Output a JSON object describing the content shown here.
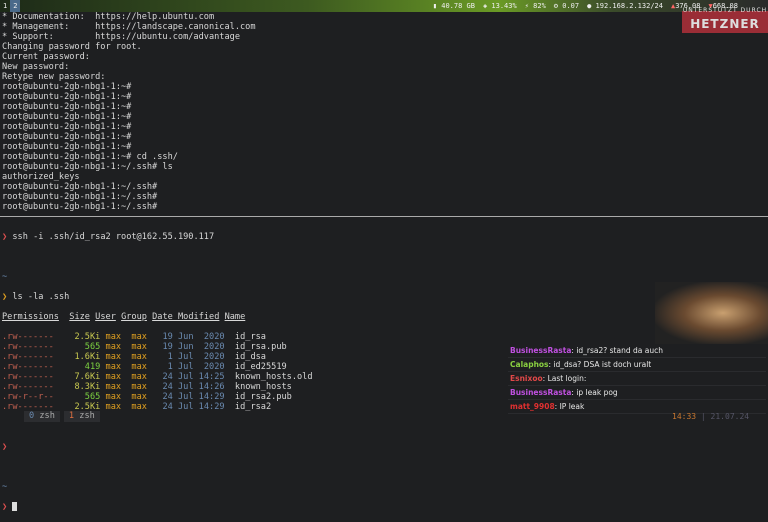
{
  "topbar": {
    "workspaces": [
      "1",
      "2"
    ],
    "disk": "40.78 GB",
    "cpu": "13.43%",
    "mem": "82%",
    "load": "0.07",
    "ip": "192.168.2.132/24",
    "up": "376.08",
    "down": "668.08"
  },
  "logo": {
    "top": "UNTERSTÜTZT DURCH",
    "name": "HETZNER"
  },
  "top_pane": [
    "* Documentation:  https://help.ubuntu.com",
    "* Management:     https://landscape.canonical.com",
    "* Support:        https://ubuntu.com/advantage",
    "Changing password for root.",
    "Current password:",
    "New password:",
    "Retype new password:",
    "root@ubuntu-2gb-nbg1-1:~#",
    "root@ubuntu-2gb-nbg1-1:~#",
    "root@ubuntu-2gb-nbg1-1:~#",
    "root@ubuntu-2gb-nbg1-1:~#",
    "root@ubuntu-2gb-nbg1-1:~#",
    "root@ubuntu-2gb-nbg1-1:~#",
    "root@ubuntu-2gb-nbg1-1:~#",
    "root@ubuntu-2gb-nbg1-1:~# cd .ssh/",
    "root@ubuntu-2gb-nbg1-1:~/.ssh# ls",
    "authorized_keys",
    "root@ubuntu-2gb-nbg1-1:~/.ssh#",
    "root@ubuntu-2gb-nbg1-1:~/.ssh#",
    "root@ubuntu-2gb-nbg1-1:~/.ssh#"
  ],
  "bottom": {
    "prompt_symbol": "❯",
    "home": "~",
    "cmd1": "ssh -i .ssh/id_rsa2 root@162.55.190.117",
    "cmd2": "ls -la .ssh",
    "headers": [
      "Permissions",
      "Size",
      "User",
      "Group",
      "Date Modified",
      "Name"
    ],
    "rows": [
      {
        "perm": ".rw-------",
        "size": "2.5Ki",
        "user": "max",
        "group": "max",
        "date": "19 Jun  2020",
        "name": "id_rsa"
      },
      {
        "perm": ".rw-------",
        "size": "565",
        "user": "max",
        "group": "max",
        "date": "19 Jun  2020",
        "name": "id_rsa.pub"
      },
      {
        "perm": ".rw-------",
        "size": "1.6Ki",
        "user": "max",
        "group": "max",
        "date": " 1 Jul  2020",
        "name": "id_dsa"
      },
      {
        "perm": ".rw-------",
        "size": "419",
        "user": "max",
        "group": "max",
        "date": " 1 Jul  2020",
        "name": "id_ed25519"
      },
      {
        "perm": ".rw-------",
        "size": "7.6Ki",
        "user": "max",
        "group": "max",
        "date": "24 Jul 14:25",
        "name": "known_hosts.old"
      },
      {
        "perm": ".rw-------",
        "size": "8.3Ki",
        "user": "max",
        "group": "max",
        "date": "24 Jul 14:26",
        "name": "known_hosts"
      },
      {
        "perm": ".rw-r--r--",
        "size": "565",
        "user": "max",
        "group": "max",
        "date": "24 Jul 14:29",
        "name": "id_rsa2.pub"
      },
      {
        "perm": ".rw-------",
        "size": "2.5Ki",
        "user": "max",
        "group": "max",
        "date": "24 Jul 14:29",
        "name": "id_rsa2"
      }
    ]
  },
  "tabs": [
    {
      "index": "0",
      "name": "zsh"
    },
    {
      "index": "1",
      "name": "zsh"
    }
  ],
  "chat": [
    {
      "user": "BusinessRasta",
      "color": "#c050e0",
      "text": "id_rsa2? stand da auch"
    },
    {
      "user": "Calaphos",
      "color": "#8ad040",
      "text": "id_dsa? DSA ist doch uralt"
    },
    {
      "user": "Esnixoo",
      "color": "#e04848",
      "text": "Last login:"
    },
    {
      "user": "BusinessRasta",
      "color": "#c050e0",
      "text": "ip leak pog"
    },
    {
      "user": "matt_9908",
      "color": "#e03030",
      "text": "IP leak"
    }
  ],
  "clock": {
    "time": "14:33",
    "date": "21.07.24"
  }
}
